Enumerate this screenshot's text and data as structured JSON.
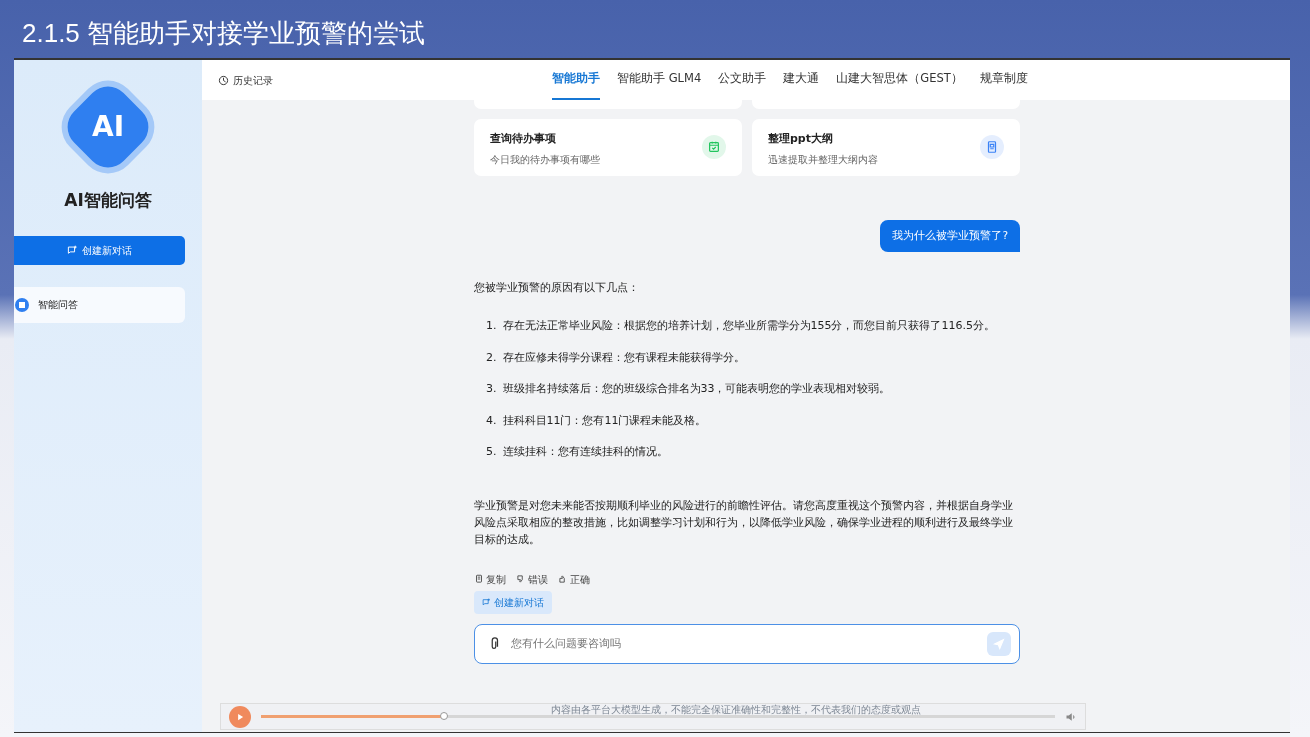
{
  "slide_title": "2.1.5 智能助手对接学业预警的尝试",
  "sidebar": {
    "logo_text": "AI",
    "app_name": "AI智能问答",
    "new_chat_button": "创建新对话",
    "items": [
      {
        "label": "智能问答",
        "selected": true
      }
    ]
  },
  "header": {
    "history": "历史记录",
    "tabs": [
      {
        "label": "智能助手",
        "selected": true
      },
      {
        "label": "智能助手 GLM4",
        "selected": false
      },
      {
        "label": "公文助手",
        "selected": false
      },
      {
        "label": "建大通",
        "selected": false
      },
      {
        "label": "山建大智思体（GEST）",
        "selected": false
      },
      {
        "label": "规章制度",
        "selected": false
      }
    ]
  },
  "cards": [
    {
      "title": "查询待办事项",
      "subtitle": "今日我的待办事项有哪些",
      "kind": "calendar",
      "color": "#22c55e"
    },
    {
      "title": "整理ppt大纲",
      "subtitle": "迅速提取并整理大纲内容",
      "kind": "document",
      "color": "#3b82f6"
    }
  ],
  "question": "我为什么被学业预警了?",
  "answer": {
    "intro": "您被学业预警的原因有以下几点：",
    "items": [
      {
        "number": "1.",
        "text": "存在无法正常毕业风险：根据您的培养计划，您毕业所需学分为155分，而您目前只获得了116.5分。"
      },
      {
        "number": "2.",
        "text": "存在应修未得学分课程：您有课程未能获得学分。"
      },
      {
        "number": "3.",
        "text": "班级排名持续落后：您的班级综合排名为33，可能表明您的学业表现相对较弱。"
      },
      {
        "number": "4.",
        "text": "挂科科目11门：您有11门课程未能及格。"
      },
      {
        "number": "5.",
        "text": "连续挂科：您有连续挂科的情况。"
      }
    ],
    "conclusion": "学业预警是对您未来能否按期顺利毕业的风险进行的前瞻性评估。请您高度重视这个预警内容，并根据自身学业风险点采取相应的整改措施，比如调整学习计划和行为，以降低学业风险，确保学业进程的顺利进行及最终学业目标的达成。"
  },
  "actions": [
    {
      "label": "复制",
      "kind": "copy"
    },
    {
      "label": "错误",
      "kind": "dislike"
    },
    {
      "label": "正确",
      "kind": "like"
    }
  ],
  "new_chat_chip": "创建新对话",
  "input": {
    "placeholder": "您有什么问题要咨询吗"
  },
  "disclaimer": "内容由各平台大模型生成，不能完全保证准确性和完整性，不代表我们的态度或观点",
  "player": {
    "level": 0.23
  }
}
